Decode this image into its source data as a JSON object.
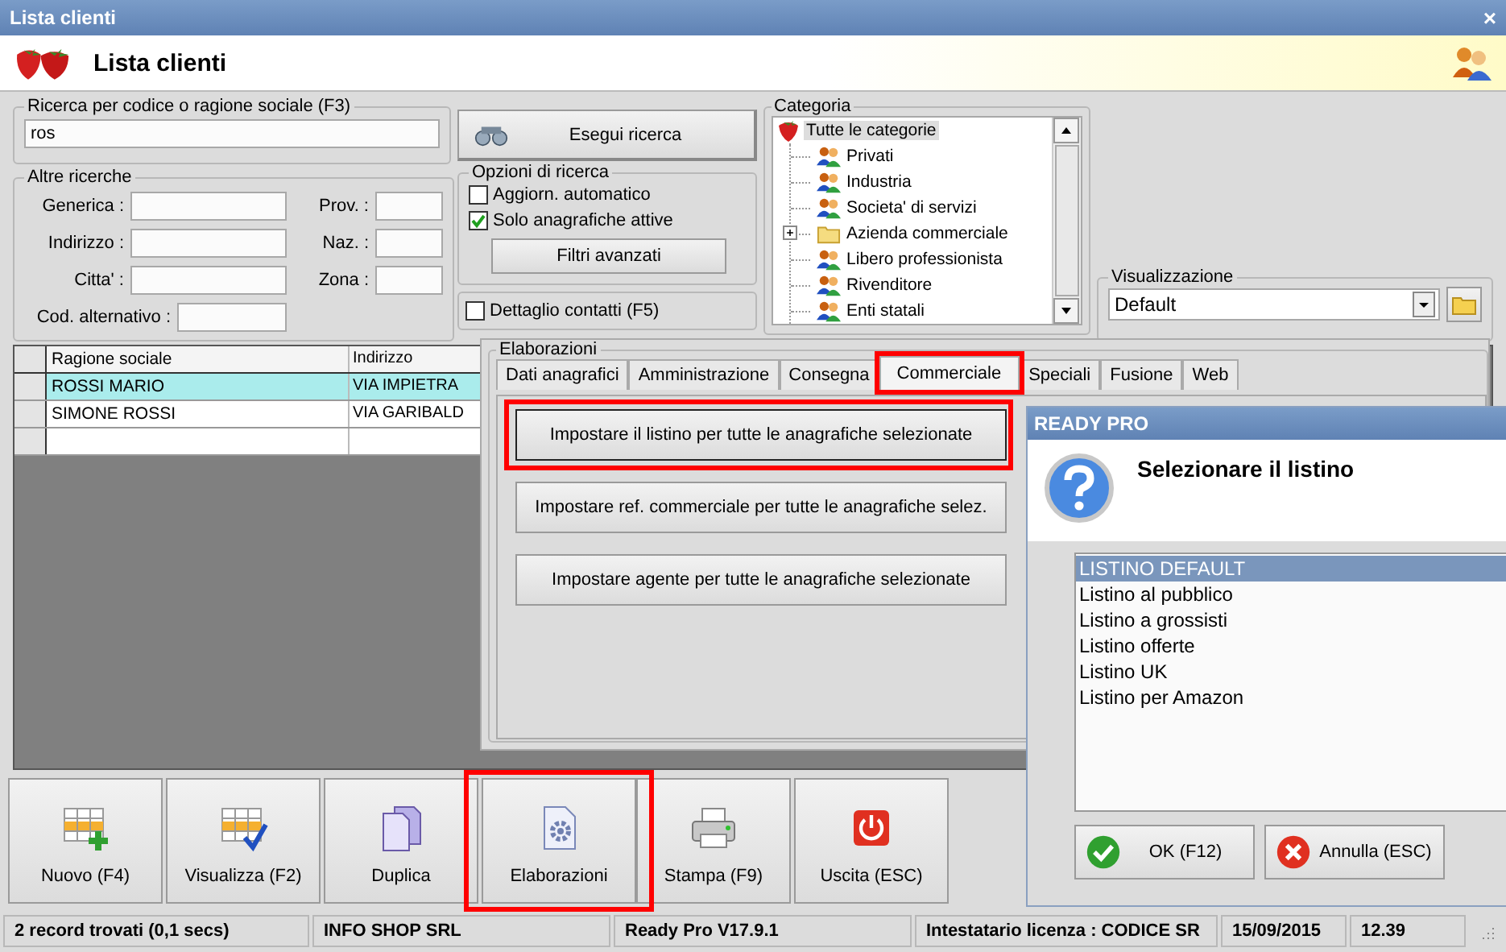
{
  "window": {
    "title": "Lista clienti",
    "close": "×"
  },
  "header": {
    "title": "Lista clienti"
  },
  "search": {
    "legend": "Ricerca per codice o ragione sociale (F3)",
    "value": "ros",
    "button": "Esegui ricerca"
  },
  "other_searches": {
    "legend": "Altre ricerche",
    "fields": [
      {
        "label": "Generica :"
      },
      {
        "label": "Indirizzo :"
      },
      {
        "label": "Citta' :"
      },
      {
        "label": "Cod. alternativo :"
      }
    ],
    "side_fields": [
      {
        "label": "Prov. :"
      },
      {
        "label": "Naz. :"
      },
      {
        "label": "Zona :"
      }
    ]
  },
  "options": {
    "legend": "Opzioni di ricerca",
    "checks": [
      {
        "label": "Aggiorn. automatico",
        "checked": false
      },
      {
        "label": "Solo anagrafiche attive",
        "checked": true
      }
    ],
    "button": "Filtri avanzati"
  },
  "contact_detail": {
    "label": "Dettaglio contatti (F5)",
    "checked": false
  },
  "category": {
    "legend": "Categoria",
    "tree": [
      {
        "label": "Tutte le categorie",
        "kind": "root",
        "selected": true,
        "children": [
          {
            "label": "Privati",
            "kind": "group",
            "selected": false
          },
          {
            "label": "Industria",
            "kind": "group",
            "selected": false
          },
          {
            "label": "Societa' di servizi",
            "kind": "group",
            "selected": false
          },
          {
            "label": "Azienda commerciale",
            "kind": "folder",
            "selected": false,
            "expanded": false
          },
          {
            "label": "Libero professionista",
            "kind": "group",
            "selected": false
          },
          {
            "label": "Rivenditore",
            "kind": "group",
            "selected": false
          },
          {
            "label": "Enti statali",
            "kind": "group",
            "selected": false
          }
        ]
      }
    ]
  },
  "view": {
    "legend": "Visualizzazione",
    "value": "Default"
  },
  "table": {
    "columns": [
      "Ragione sociale",
      "Indirizzo"
    ],
    "rows": [
      {
        "cells": [
          "ROSSI MARIO",
          "VIA IMPIETRA"
        ],
        "selected": true
      },
      {
        "cells": [
          "SIMONE ROSSI",
          "VIA GARIBALD"
        ],
        "selected": false
      }
    ]
  },
  "processing_panel": {
    "legend": "Elaborazioni",
    "tabs": [
      {
        "label": "Dati anagrafici",
        "selected": false,
        "highlighted": false
      },
      {
        "label": "Amministrazione",
        "selected": false,
        "highlighted": false
      },
      {
        "label": "Consegna",
        "selected": false,
        "highlighted": false
      },
      {
        "label": "Commerciale",
        "selected": true,
        "highlighted": true
      },
      {
        "label": "Speciali",
        "selected": false,
        "highlighted": false
      },
      {
        "label": "Fusione",
        "selected": false,
        "highlighted": false
      },
      {
        "label": "Web",
        "selected": false,
        "highlighted": false
      }
    ],
    "actions": [
      {
        "label": "Impostare il listino per tutte le anagrafiche selezionate",
        "highlighted": true
      },
      {
        "label": "Impostare ref. commerciale per tutte le anagrafiche selez.",
        "highlighted": false
      },
      {
        "label": "Impostare agente per tutte le anagrafiche selezionate",
        "highlighted": false
      }
    ]
  },
  "dialog": {
    "title": "READY PRO",
    "heading": "Selezionare il listino",
    "items": [
      {
        "label": "LISTINO DEFAULT",
        "selected": true
      },
      {
        "label": "Listino al pubblico",
        "selected": false
      },
      {
        "label": "Listino a grossisti",
        "selected": false
      },
      {
        "label": "Listino offerte",
        "selected": false
      },
      {
        "label": "Listino UK",
        "selected": false
      },
      {
        "label": "Listino per Amazon",
        "selected": false
      }
    ],
    "buttons": [
      {
        "label": "OK (F12)",
        "kind": "ok"
      },
      {
        "label": "Annulla (ESC)",
        "kind": "cancel"
      }
    ]
  },
  "toolbar": [
    {
      "label": "Nuovo (F4)",
      "kind": "new",
      "highlighted": false
    },
    {
      "label": "Visualizza (F2)",
      "kind": "view",
      "highlighted": false
    },
    {
      "label": "Duplica",
      "kind": "copy",
      "highlighted": false
    },
    {
      "label": "Elaborazioni",
      "kind": "process",
      "highlighted": true
    },
    {
      "label": "Stampa (F9)",
      "kind": "print",
      "highlighted": false
    },
    {
      "label": "Uscita (ESC)",
      "kind": "exit",
      "highlighted": false
    }
  ],
  "status_bar": [
    "2 record trovati (0,1 secs)",
    "INFO SHOP SRL",
    "Ready Pro V17.9.1",
    "Intestatario licenza : CODICE SR",
    "15/09/2015",
    "12.39"
  ]
}
